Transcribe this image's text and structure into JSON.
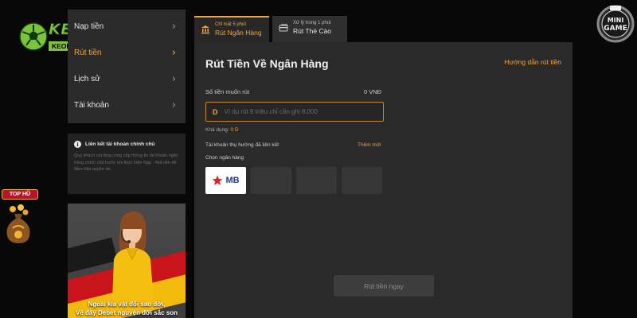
{
  "logo": {
    "main": "KEONHACAI",
    "sub": "KEONHACAIS.IN.NET"
  },
  "menu": {
    "items": [
      {
        "label": "Nạp tiền"
      },
      {
        "label": "Rút tiền"
      },
      {
        "label": "Lịch sử"
      },
      {
        "label": "Tài khoản"
      }
    ],
    "active_index": 1
  },
  "info": {
    "title": "Liên kết tài khoản chính chủ",
    "text": "Quý khách vui lòng cung cấp thông tin tài khoản ngân hàng chính chủ trước khi thực hiện Nạp - Rút tiền để đảm bảo quyền lợi."
  },
  "promo": {
    "line1": "Ngoài kia vật đổi sao dời,",
    "line2": "Về đây Debet nguyện đời sắc son"
  },
  "tophu": {
    "label": "TOP HŨ"
  },
  "tabs": [
    {
      "small": "Chỉ mất 5 phút",
      "big": "Rút Ngân Hàng",
      "active": true
    },
    {
      "small": "Xử lý trong 1 phút",
      "big": "Rút Thẻ Cào",
      "active": false
    }
  ],
  "panel": {
    "title": "Rút Tiền Về Ngân Hàng",
    "guide": "Hướng dẫn rút tiền",
    "amount_label": "Số tiền muốn rút",
    "amount_unit": "0 VNĐ",
    "currency_mark": "D",
    "amount_placeholder": "Ví dụ rút 8 triệu chỉ cần ghi 8.000",
    "available_label": "Khả dụng:",
    "available_value": "0 D",
    "linked_label": "Tài khoản thụ hưởng đã liên kết",
    "add_new": "Thêm mới",
    "bank_label": "Chọn ngân hàng",
    "banks": [
      "MB",
      "",
      "",
      ""
    ],
    "submit": "Rút tiền ngay"
  },
  "colors": {
    "accent": "#f2a53a",
    "panel": "#2a2a2a",
    "background": "#080808",
    "logo_green": "#7ec43a"
  }
}
